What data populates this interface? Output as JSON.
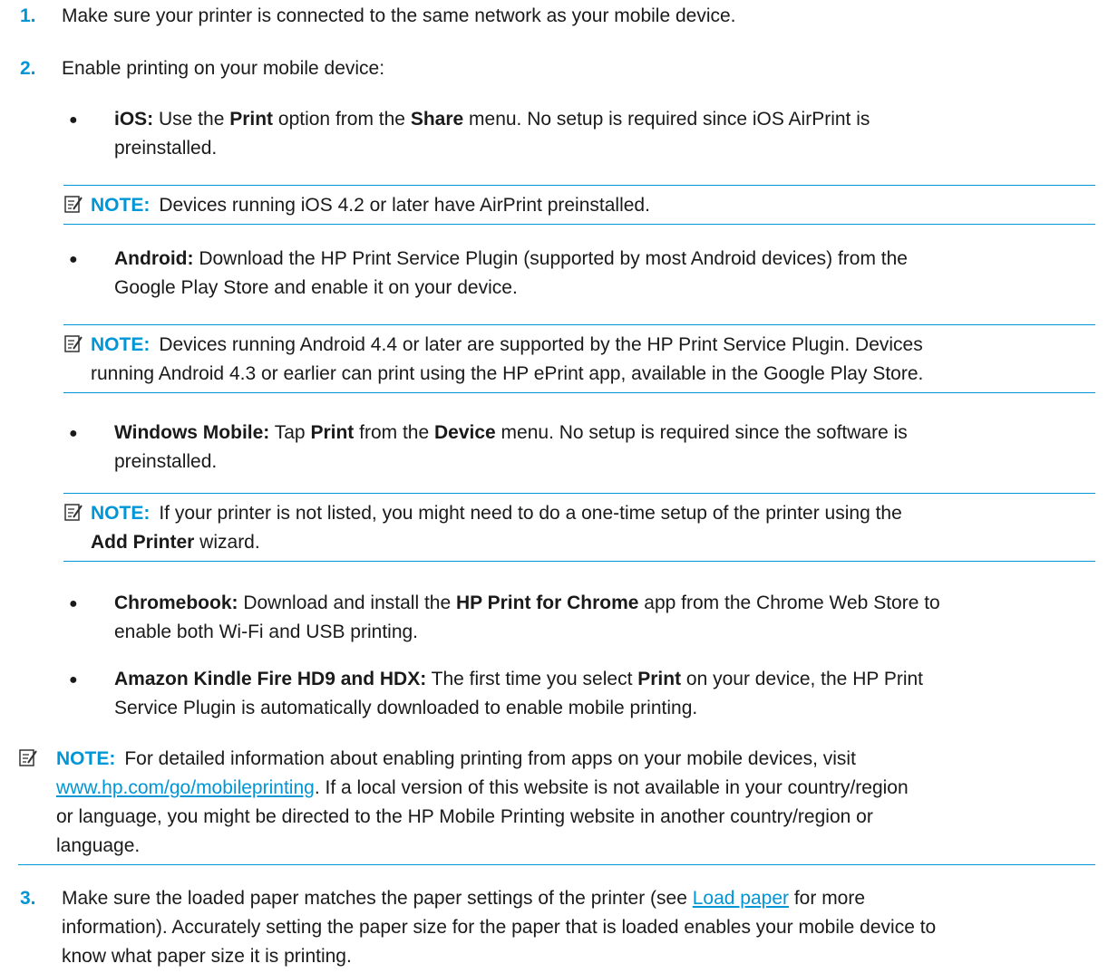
{
  "icon_color": "#0096d6",
  "steps": [
    {
      "number": "1.",
      "text": "Make sure your printer is connected to the same network as your mobile device."
    },
    {
      "number": "2.",
      "text": "Enable printing on your mobile device:"
    },
    {
      "number": "3.",
      "text_a": "Make sure the loaded paper matches the paper settings of the printer (see ",
      "link": "Load paper",
      "text_b": " for more",
      "line2": "information). Accurately setting the paper size for the paper that is loaded enables your mobile device to",
      "line3": "know what paper size it is printing."
    }
  ],
  "note_label": "NOTE:",
  "items": {
    "ios": {
      "title": "iOS:",
      "t1": " Use the ",
      "b1": "Print",
      "t2": " option from the ",
      "b2": "Share",
      "t3": " menu. No setup is required since iOS AirPrint is",
      "line2": "preinstalled."
    },
    "ios_note": "Devices running iOS 4.2 or later have AirPrint preinstalled.",
    "android": {
      "title": "Android:",
      "t1": " Download the HP Print Service Plugin (supported by most Android devices) from the",
      "line2": "Google Play Store and enable it on your device."
    },
    "android_note": {
      "line1": "Devices running Android 4.4 or later are supported by the HP Print Service Plugin. Devices",
      "line2": "running Android 4.3 or earlier can print using the HP ePrint app, available in the Google Play Store."
    },
    "windows": {
      "title": "Windows Mobile:",
      "t1": " Tap ",
      "b1": "Print",
      "t2": " from the ",
      "b2": "Device",
      "t3": " menu. No setup is required since the software is",
      "line2": "preinstalled."
    },
    "windows_note": {
      "line1": "If your printer is not listed, you might need to do a one-time setup of the printer using the",
      "b1": "Add Printer",
      "t2": " wizard."
    },
    "chromebook": {
      "title": "Chromebook:",
      "t1": " Download and install the ",
      "b1": "HP Print for Chrome",
      "t2": " app from the Chrome Web Store to",
      "line2": "enable both Wi-Fi and USB printing."
    },
    "kindle": {
      "title": "Amazon Kindle Fire HD9 and HDX:",
      "t1": " The first time you select ",
      "b1": "Print",
      "t2": " on your device, the HP Print",
      "line2": "Service Plugin is automatically downloaded to enable mobile printing."
    }
  },
  "general_note": {
    "line1": "For detailed information about enabling printing from apps on your mobile devices, visit",
    "link": "www.hp.com/go/mobileprinting",
    "line2_rest": ". If a local version of this website is not available in your country/region",
    "line3": "or language, you might be directed to the HP Mobile Printing website in another country/region or",
    "line4": "language."
  }
}
